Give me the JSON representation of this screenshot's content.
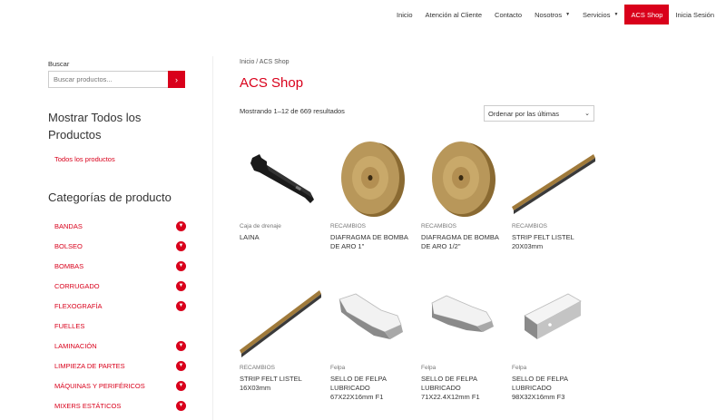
{
  "nav": {
    "items": [
      {
        "label": "Inicio",
        "dropdown": false,
        "active": false
      },
      {
        "label": "Atención al Cliente",
        "dropdown": false,
        "active": false
      },
      {
        "label": "Contacto",
        "dropdown": false,
        "active": false
      },
      {
        "label": "Nosotros",
        "dropdown": true,
        "active": false
      },
      {
        "label": "Servicios",
        "dropdown": true,
        "active": false
      },
      {
        "label": "ACS Shop",
        "dropdown": false,
        "active": true
      },
      {
        "label": "Inicia Sesión",
        "dropdown": false,
        "active": false
      }
    ]
  },
  "sidebar": {
    "search_label": "Buscar",
    "search_placeholder": "Buscar productos...",
    "all_heading": "Mostrar Todos los Productos",
    "all_link": "Todos los productos",
    "categories_heading": "Categorías de producto",
    "categories": [
      {
        "label": "BANDAS",
        "expandable": true
      },
      {
        "label": "BOLSEO",
        "expandable": true
      },
      {
        "label": "BOMBAS",
        "expandable": true
      },
      {
        "label": "CORRUGADO",
        "expandable": true
      },
      {
        "label": "FLEXOGRAFÍA",
        "expandable": true
      },
      {
        "label": "FUELLES",
        "expandable": false
      },
      {
        "label": "LAMINACIÓN",
        "expandable": true
      },
      {
        "label": "LIMPIEZA DE PARTES",
        "expandable": true
      },
      {
        "label": "MÁQUINAS Y PERIFÉRICOS",
        "expandable": true
      },
      {
        "label": "MIXERS ESTÁTICOS",
        "expandable": true
      }
    ]
  },
  "main": {
    "breadcrumb": "Inicio / ACS Shop",
    "title": "ACS Shop",
    "results": "Mostrando 1–12 de 669 resultados",
    "orderby": "Ordenar por las últimas",
    "products": [
      {
        "category": "Caja de drenaje",
        "name": "LAINA",
        "image": "bracket-image"
      },
      {
        "category": "RECAMBIOS",
        "name": "DIAFRAGMA DE BOMBA DE ARO 1\"",
        "image": "diaphragm-image"
      },
      {
        "category": "RECAMBIOS",
        "name": "DIAFRAGMA DE BOMBA DE ARO 1/2\"",
        "image": "diaphragm-image"
      },
      {
        "category": "RECAMBIOS",
        "name": "STRIP FELT LISTEL 20X03mm",
        "image": "strip-image"
      },
      {
        "category": "RECAMBIOS",
        "name": "STRIP FELT LISTEL 16X03mm",
        "image": "strip-image"
      },
      {
        "category": "Felpa",
        "name": "SELLO DE FELPA LUBRICADO 67X22X16mm F1",
        "image": "felt-seal-image"
      },
      {
        "category": "Felpa",
        "name": "SELLO DE FELPA LUBRICADO 71X22.4X12mm F1",
        "image": "felt-seal-image"
      },
      {
        "category": "Felpa",
        "name": "SELLO DE FELPA LUBRICADO 98X32X16mm F3",
        "image": "felt-block-image"
      }
    ]
  },
  "colors": {
    "accent": "#d9001b",
    "brass": "#b8975a"
  }
}
